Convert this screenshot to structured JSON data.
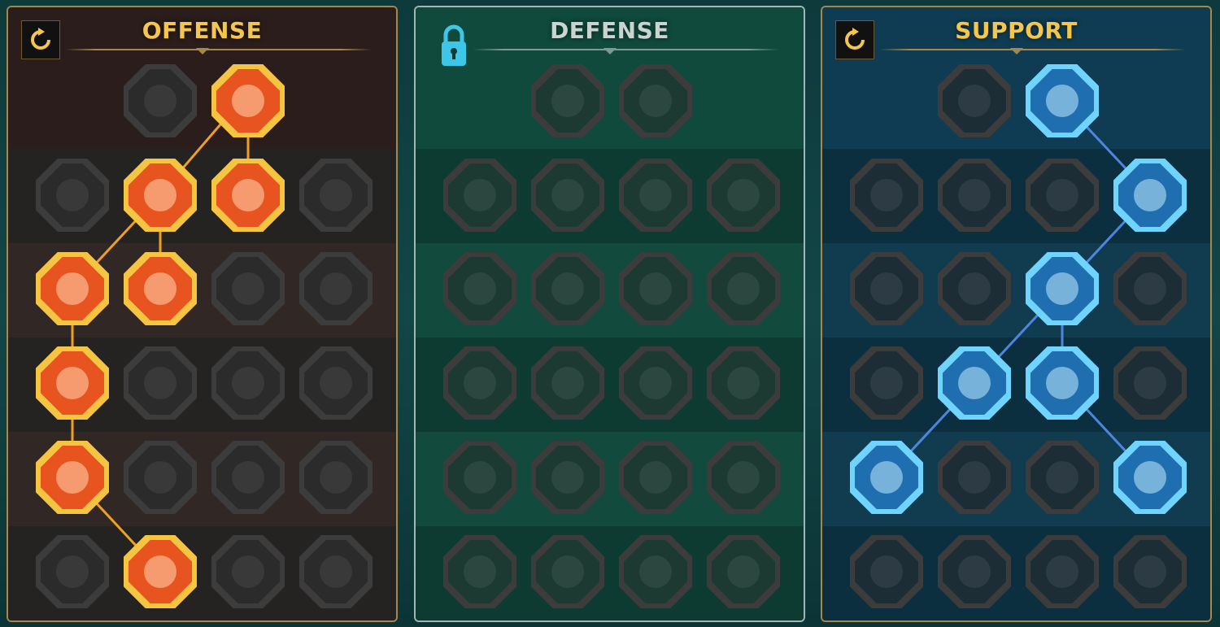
{
  "panels": {
    "offense": {
      "title": "OFFENSE",
      "reset_icon": "reset-icon"
    },
    "defense": {
      "title": "DEFENSE",
      "lock_icon": "padlock-icon"
    },
    "support": {
      "title": "SUPPORT",
      "reset_icon": "reset-icon"
    }
  },
  "colors": {
    "offense_active": "#e8541f",
    "offense_border": "#f5c542",
    "support_active": "#1f6fb0",
    "support_border": "#6fd4ff",
    "inactive_fill": "#2b2b2b",
    "inactive_border": "#3c3c3c"
  }
}
